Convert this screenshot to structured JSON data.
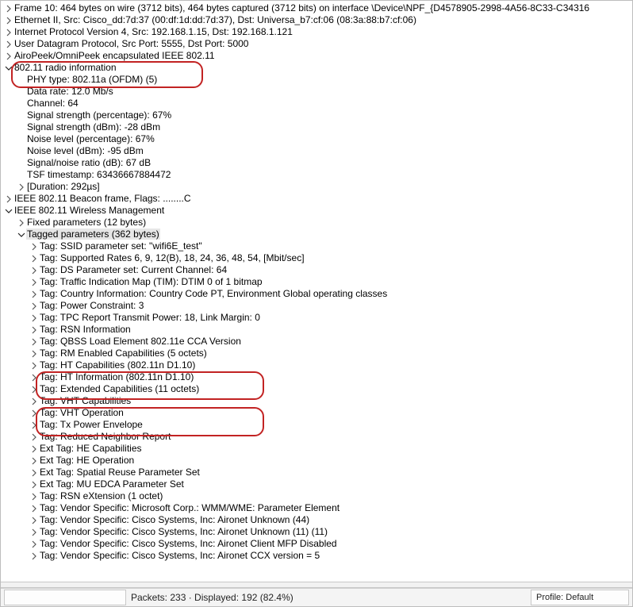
{
  "frame": {
    "summary": "Frame 10: 464 bytes on wire (3712 bits), 464 bytes captured (3712 bits) on interface \\Device\\NPF_{D4578905-2998-4A56-8C33-C34316",
    "eth": "Ethernet II, Src: Cisco_dd:7d:37 (00:df:1d:dd:7d:37), Dst: Universa_b7:cf:06 (08:3a:88:b7:cf:06)",
    "ip": "Internet Protocol Version 4, Src: 192.168.1.15, Dst: 192.168.1.121",
    "udp": "User Datagram Protocol, Src Port: 5555, Dst Port: 5000",
    "airo": "AiroPeek/OmniPeek encapsulated IEEE 802.11"
  },
  "radio": {
    "header": "802.11 radio information",
    "phy": "PHY type: 802.11a (OFDM) (5)",
    "rate": "Data rate: 12.0 Mb/s",
    "channel": "Channel: 64",
    "sig_pct": "Signal strength (percentage): 67%",
    "sig_dbm": "Signal strength (dBm): -28 dBm",
    "noise_pct": "Noise level (percentage): 67%",
    "noise_dbm": "Noise level (dBm): -95 dBm",
    "snr": "Signal/noise ratio (dB): 67 dB",
    "tsf": "TSF timestamp: 63436667884472",
    "dur": "[Duration: 292µs]"
  },
  "beacon": "IEEE 802.11 Beacon frame, Flags: ........C",
  "mgmt": {
    "header": "IEEE 802.11 Wireless Management",
    "fixed": "Fixed parameters (12 bytes)",
    "tagged": "Tagged parameters (362 bytes)",
    "tags": [
      "Tag: SSID parameter set: \"wifi6E_test\"",
      "Tag: Supported Rates 6, 9, 12(B), 18, 24, 36, 48, 54, [Mbit/sec]",
      "Tag: DS Parameter set: Current Channel: 64",
      "Tag: Traffic Indication Map (TIM): DTIM 0 of 1 bitmap",
      "Tag: Country Information: Country Code PT, Environment Global operating classes",
      "Tag: Power Constraint: 3",
      "Tag: TPC Report Transmit Power: 18, Link Margin: 0",
      "Tag: RSN Information",
      "Tag: QBSS Load Element 802.11e CCA Version",
      "Tag: RM Enabled Capabilities (5 octets)",
      "Tag: HT Capabilities (802.11n D1.10)",
      "Tag: HT Information (802.11n D1.10)",
      "Tag: Extended Capabilities (11 octets)",
      "Tag: VHT Capabilities",
      "Tag: VHT Operation",
      "Tag: Tx Power Envelope",
      "Tag: Reduced Neighbor Report",
      "Ext Tag: HE Capabilities",
      "Ext Tag: HE Operation",
      "Ext Tag: Spatial Reuse Parameter Set",
      "Ext Tag: MU EDCA Parameter Set",
      "Tag: RSN eXtension (1 octet)",
      "Tag: Vendor Specific: Microsoft Corp.: WMM/WME: Parameter Element",
      "Tag: Vendor Specific: Cisco Systems, Inc: Aironet Unknown (44)",
      "Tag: Vendor Specific: Cisco Systems, Inc: Aironet Unknown (11) (11)",
      "Tag: Vendor Specific: Cisco Systems, Inc: Aironet Client MFP Disabled",
      "Tag: Vendor Specific: Cisco Systems, Inc: Aironet CCX version = 5"
    ]
  },
  "status": {
    "packets": "Packets: 233 · Displayed: 192 (82.4%)",
    "profile": "Profile: Default"
  },
  "glyph": {
    "right": "›",
    "down": "⌄"
  }
}
